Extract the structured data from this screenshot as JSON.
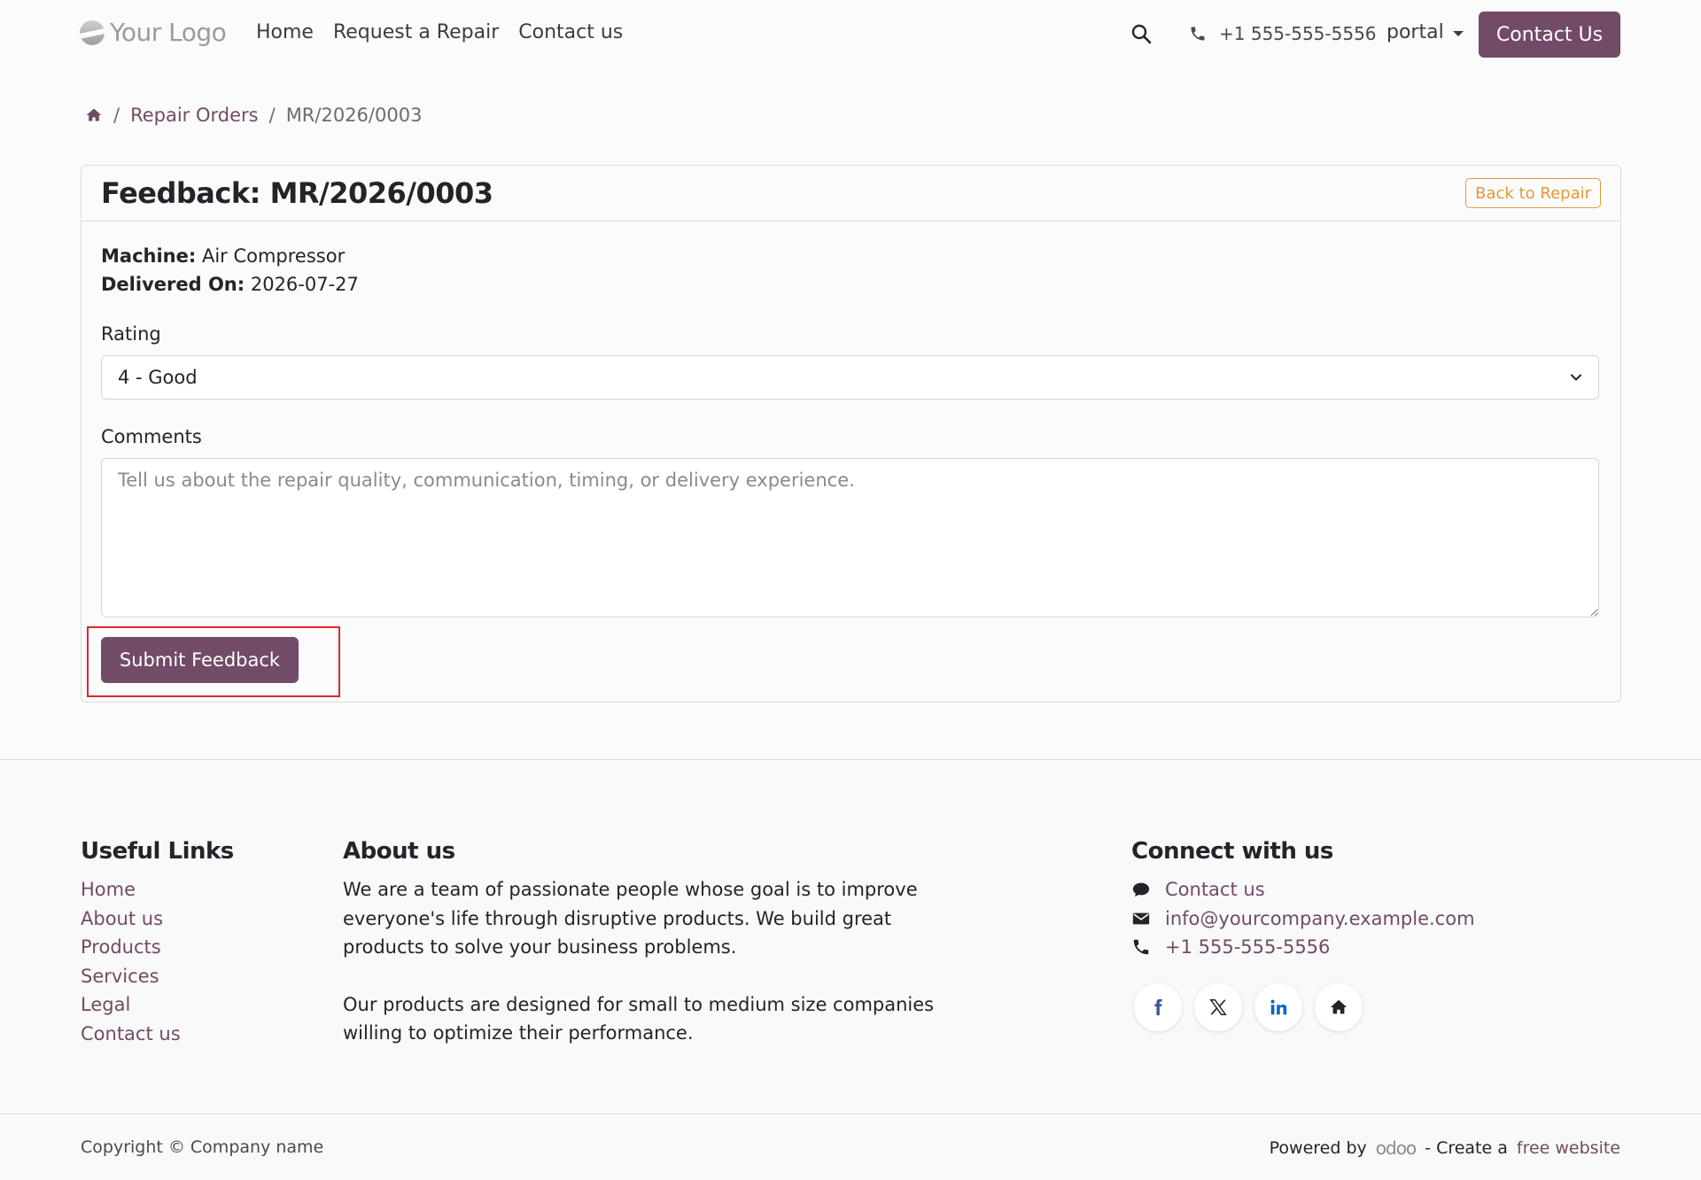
{
  "header": {
    "logo_text": "Your Logo",
    "nav": [
      "Home",
      "Request a Repair",
      "Contact us"
    ],
    "phone": "+1 555-555-5556",
    "user_menu": "portal",
    "contact_button": "Contact Us"
  },
  "breadcrumb": {
    "items": [
      "Repair Orders",
      "MR/2026/0003"
    ],
    "separator": "/"
  },
  "card": {
    "title": "Feedback: MR/2026/0003",
    "back_button": "Back to Repair",
    "machine_label": "Machine:",
    "machine_value": "Air Compressor",
    "delivered_label": "Delivered On:",
    "delivered_value": "2026-07-27",
    "rating_label": "Rating",
    "rating_selected": "4 - Good",
    "comments_label": "Comments",
    "comments_placeholder": "Tell us about the repair quality, communication, timing, or delivery experience.",
    "submit_button": "Submit Feedback"
  },
  "footer": {
    "useful_links_title": "Useful Links",
    "useful_links": [
      "Home",
      "About us",
      "Products",
      "Services",
      "Legal",
      "Contact us"
    ],
    "about_title": "About us",
    "about_p1": "We are a team of passionate people whose goal is to improve everyone's life through disruptive products. We build great products to solve your business problems.",
    "about_p2": "Our products are designed for small to medium size companies willing to optimize their performance.",
    "connect_title": "Connect with us",
    "connect_contact": "Contact us",
    "connect_email": "info@yourcompany.example.com",
    "connect_phone": "+1 555-555-5556",
    "social_icons": [
      "facebook-icon",
      "x-twitter-icon",
      "linkedin-icon",
      "home-icon"
    ],
    "copyright": "Copyright © Company name",
    "powered_by": "Powered by",
    "odoo_brand": "odoo",
    "create_prefix": "- Create a",
    "free_website": "free website"
  },
  "colors": {
    "brand": "#714b67",
    "outline_warning": "#e29a3b",
    "highlight": "#e0262d"
  }
}
